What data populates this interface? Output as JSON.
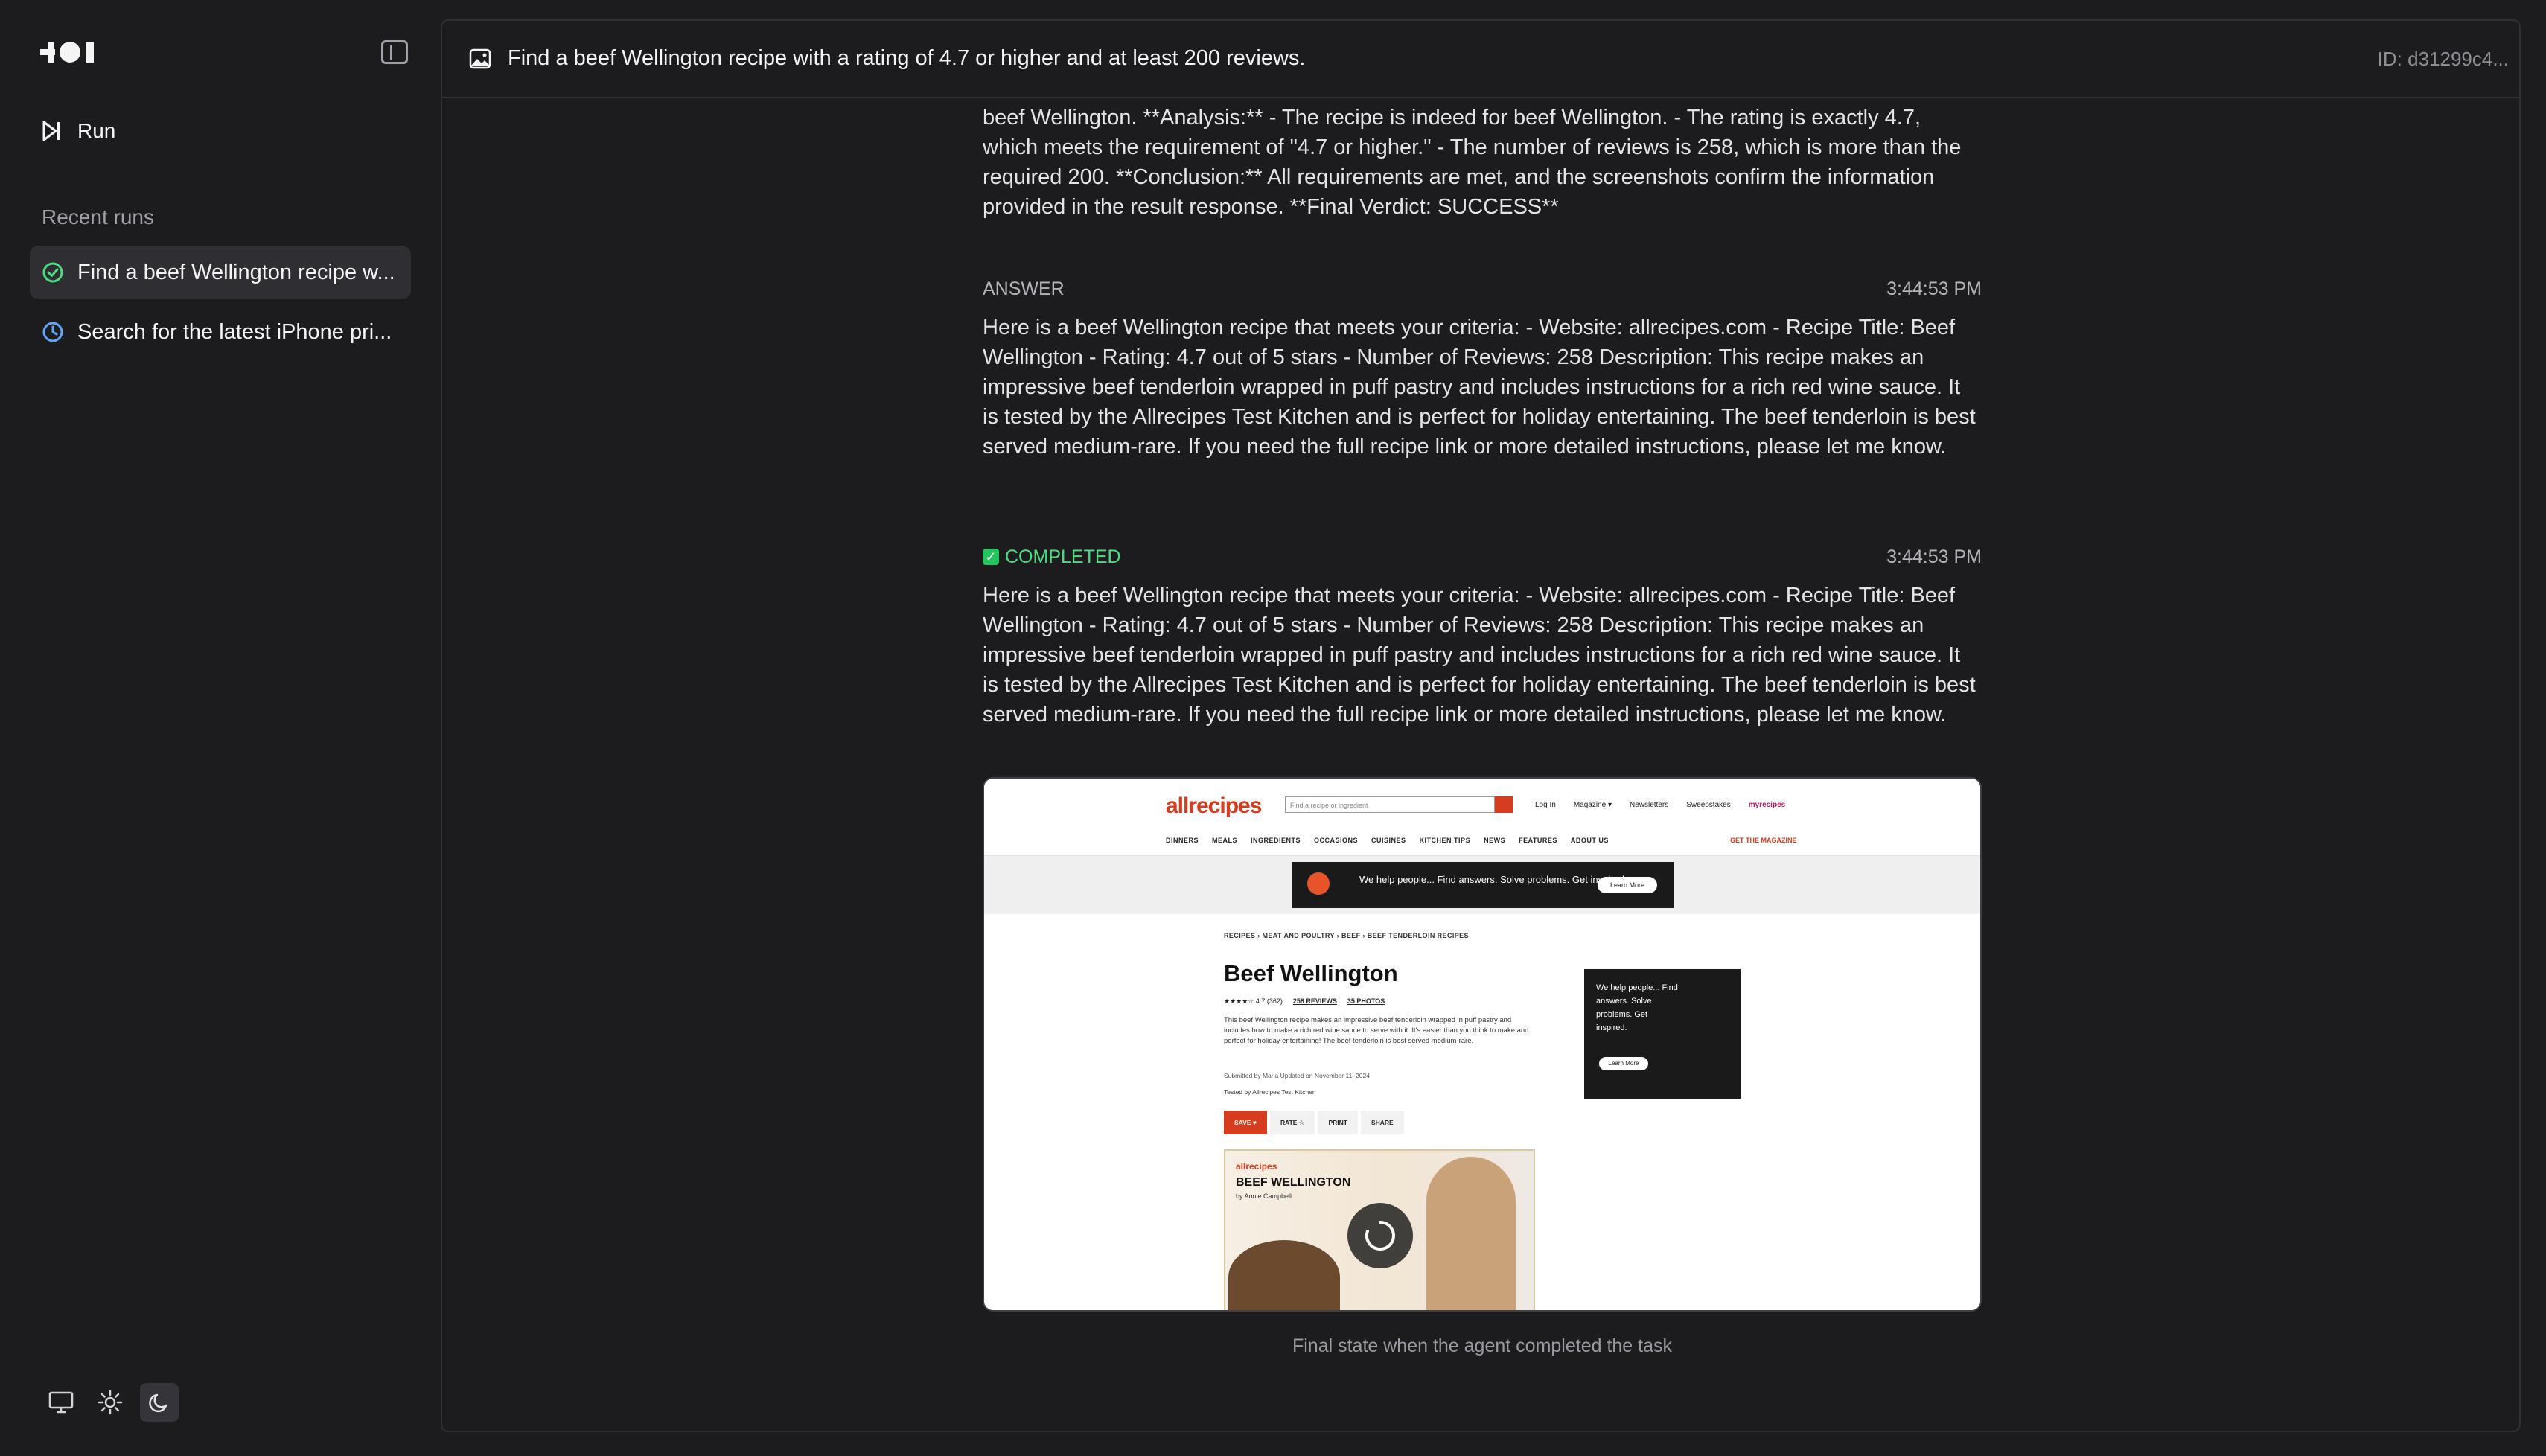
{
  "app": {
    "sidebar_toggle_icon": "sidebar-toggle-icon"
  },
  "sidebar": {
    "run_label": "Run",
    "recent_label": "Recent runs",
    "runs": [
      {
        "label": "Find a beef Wellington recipe w...",
        "status": "success"
      },
      {
        "label": "Search for the latest iPhone pri...",
        "status": "pending"
      }
    ],
    "theme_options": [
      "system",
      "light",
      "dark"
    ],
    "active_theme": "dark"
  },
  "header": {
    "title": "Find a beef Wellington recipe with a rating of 4.7 or higher and at least 200 reviews.",
    "id": "ID: d31299c4..."
  },
  "messages": {
    "verdict_text": "beef Wellington. **Analysis:** - The recipe is indeed for beef Wellington. - The rating is exactly 4.7, which meets the requirement of \"4.7 or higher.\" - The number of reviews is 258, which is more than the required 200. **Conclusion:** All requirements are met, and the screenshots confirm the information provided in the result response. **Final Verdict: SUCCESS**",
    "answer": {
      "label": "ANSWER",
      "time": "3:44:53 PM",
      "text": "Here is a beef Wellington recipe that meets your criteria: - Website: allrecipes.com - Recipe Title: Beef Wellington - Rating: 4.7 out of 5 stars - Number of Reviews: 258 Description: This recipe makes an impressive beef tenderloin wrapped in puff pastry and includes instructions for a rich red wine sauce. It is tested by the Allrecipes Test Kitchen and is perfect for holiday entertaining. The beef tenderloin is best served medium-rare. If you need the full recipe link or more detailed instructions, please let me know."
    },
    "completed": {
      "label": "COMPLETED",
      "time": "3:44:53 PM",
      "text": "Here is a beef Wellington recipe that meets your criteria: - Website: allrecipes.com - Recipe Title: Beef Wellington - Rating: 4.7 out of 5 stars - Number of Reviews: 258 Description: This recipe makes an impressive beef tenderloin wrapped in puff pastry and includes instructions for a rich red wine sauce. It is tested by the Allrecipes Test Kitchen and is perfect for holiday entertaining. The beef tenderloin is best served medium-rare. If you need the full recipe link or more detailed instructions, please let me know."
    },
    "caption": "Final state when the agent completed the task"
  },
  "screenshot": {
    "logo": "allrecipes",
    "search_placeholder": "Find a recipe or ingredient",
    "links": [
      "Log In",
      "Magazine ▾",
      "Newsletters",
      "Sweepstakes",
      "myrecipes"
    ],
    "nav": [
      "DINNERS",
      "MEALS",
      "INGREDIENTS",
      "OCCASIONS",
      "CUISINES",
      "KITCHEN TIPS",
      "NEWS",
      "FEATURES",
      "ABOUT US"
    ],
    "nav_right": "GET THE MAGAZINE",
    "ad_text": "We help people... Find answers. Solve problems. Get inspired.",
    "ad_button": "Learn More",
    "breadcrumb": "RECIPES › MEAT AND POULTRY › BEEF › BEEF TENDERLOIN RECIPES",
    "title": "Beef Wellington",
    "rating": "★★★★☆ 4.7 (362)",
    "reviews": "258 REVIEWS",
    "photos": "35 PHOTOS",
    "description": "This beef Wellington recipe makes an impressive beef tenderloin wrapped in puff pastry and includes how to make a rich red wine sauce to serve with it. It's easier than you think to make and perfect for holiday entertaining! The beef tenderloin is best served medium-rare.",
    "submitted": "Submitted by Marla   Updated on November 11, 2024",
    "tested": "Tested by Allrecipes Test Kitchen",
    "actions": [
      "SAVE ♥",
      "RATE ☆",
      "PRINT",
      "SHARE"
    ],
    "video_title": "BEEF WELLINGTON",
    "video_sub": "by Annie Campbell",
    "side_ad": "We help people... Find answers. Solve problems. Get inspired."
  }
}
